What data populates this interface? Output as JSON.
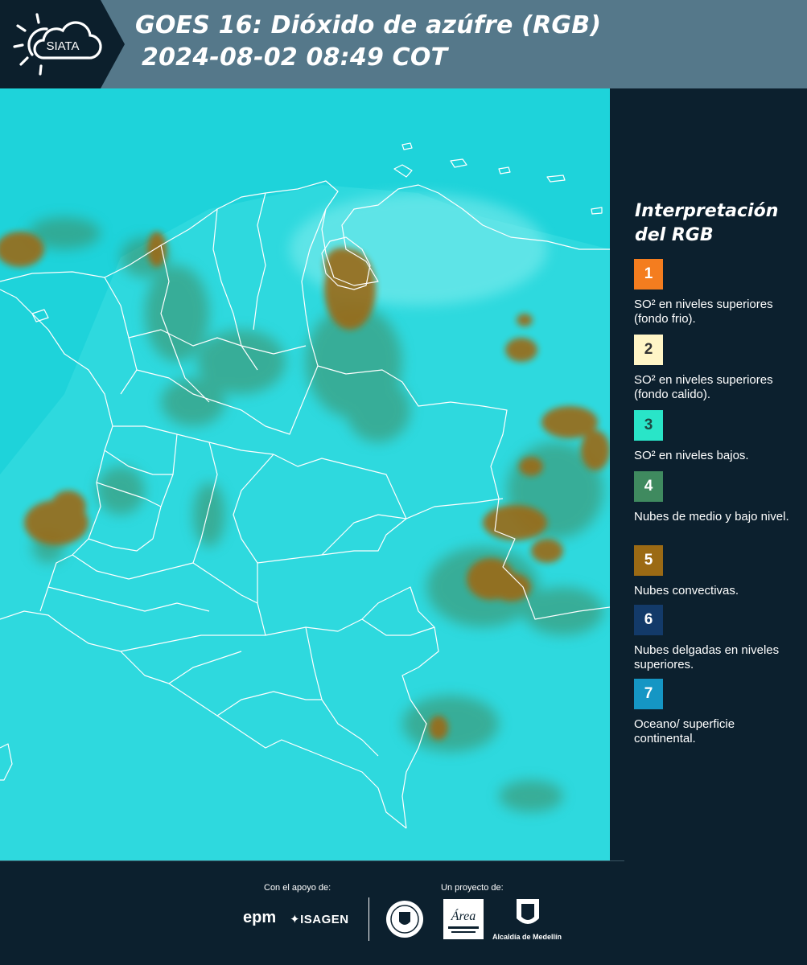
{
  "header": {
    "brand": "SIATA",
    "title_line1": "GOES 16: Dióxido de azúfre (RGB)",
    "title_line2": "2024-08-02 08:49 COT"
  },
  "legend": {
    "heading_line1": "Interpretación",
    "heading_line2": "del RGB",
    "items": [
      {
        "number": "1",
        "label": "SO² en niveles superiores (fondo frio).",
        "color": "#f47d1f",
        "text_color": "#ffffff"
      },
      {
        "number": "2",
        "label": "SO² en niveles superiores (fondo calido).",
        "color": "#fff5c6",
        "text_color": "#333333"
      },
      {
        "number": "3",
        "label": "SO² en niveles bajos.",
        "color": "#29e5c8",
        "text_color": "#1d4a44"
      },
      {
        "number": "4",
        "label": "Nubes de medio y bajo nivel.",
        "color": "#3f8a5f",
        "text_color": "#ffffff"
      },
      {
        "number": "5",
        "label": "Nubes convectivas.",
        "color": "#9b6a14",
        "text_color": "#ffffff"
      },
      {
        "number": "6",
        "label": "Nubes delgadas en niveles superiores.",
        "color": "#133a69",
        "text_color": "#ffffff"
      },
      {
        "number": "7",
        "label": "Oceano/ superficie continental.",
        "color": "#1596c4",
        "text_color": "#ffffff"
      }
    ]
  },
  "map": {
    "ocean_color": "#1ed3da",
    "land_color": "#34dcdf",
    "border_color": "#ffffff",
    "cloud_low_color": "#3f8a5f",
    "cloud_convective_color": "#9b6a14"
  },
  "footer": {
    "support_caption": "Con el apoyo de:",
    "project_caption": "Un proyecto de:",
    "epm": "epm",
    "isagen": "ISAGEN",
    "area_logo_text": "Área",
    "alcaldia": "Alcaldía de Medellín"
  }
}
